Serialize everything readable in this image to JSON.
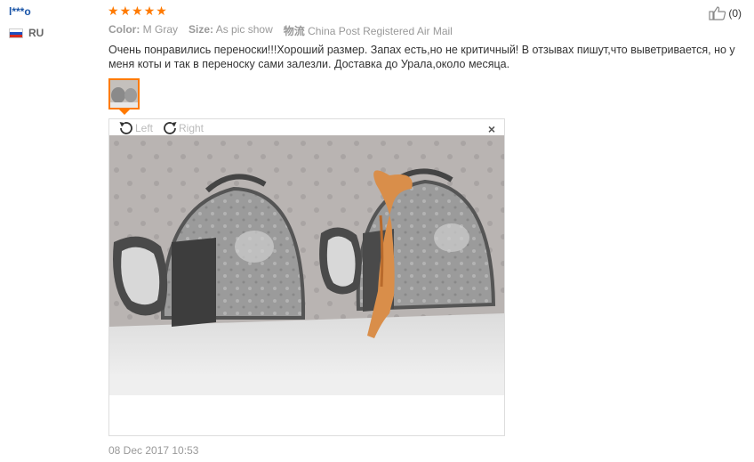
{
  "review": {
    "user_name": "l***o",
    "country_code": "RU",
    "rating_stars": 5,
    "star_glyph": "★",
    "helpful_count": "(0)",
    "props": [
      {
        "label": "Color:",
        "value": "M Gray"
      },
      {
        "label": "Size:",
        "value": "As pic show"
      },
      {
        "label": "物流",
        "value": "China Post Registered Air Mail"
      }
    ],
    "text": "Очень понравились переноски!!!Хороший размер. Запах есть,но не критичный! В отзывах пишут,что выветривается, но у меня коты и так в переноску сами залезли. Доставка до Урала,около месяца.",
    "date": "08 Dec 2017 10:53"
  },
  "viewer": {
    "rotate_left": "Left",
    "rotate_right": "Right",
    "close": "×"
  },
  "colors": {
    "accent": "#ff7a00",
    "username": "#1a55a8"
  }
}
